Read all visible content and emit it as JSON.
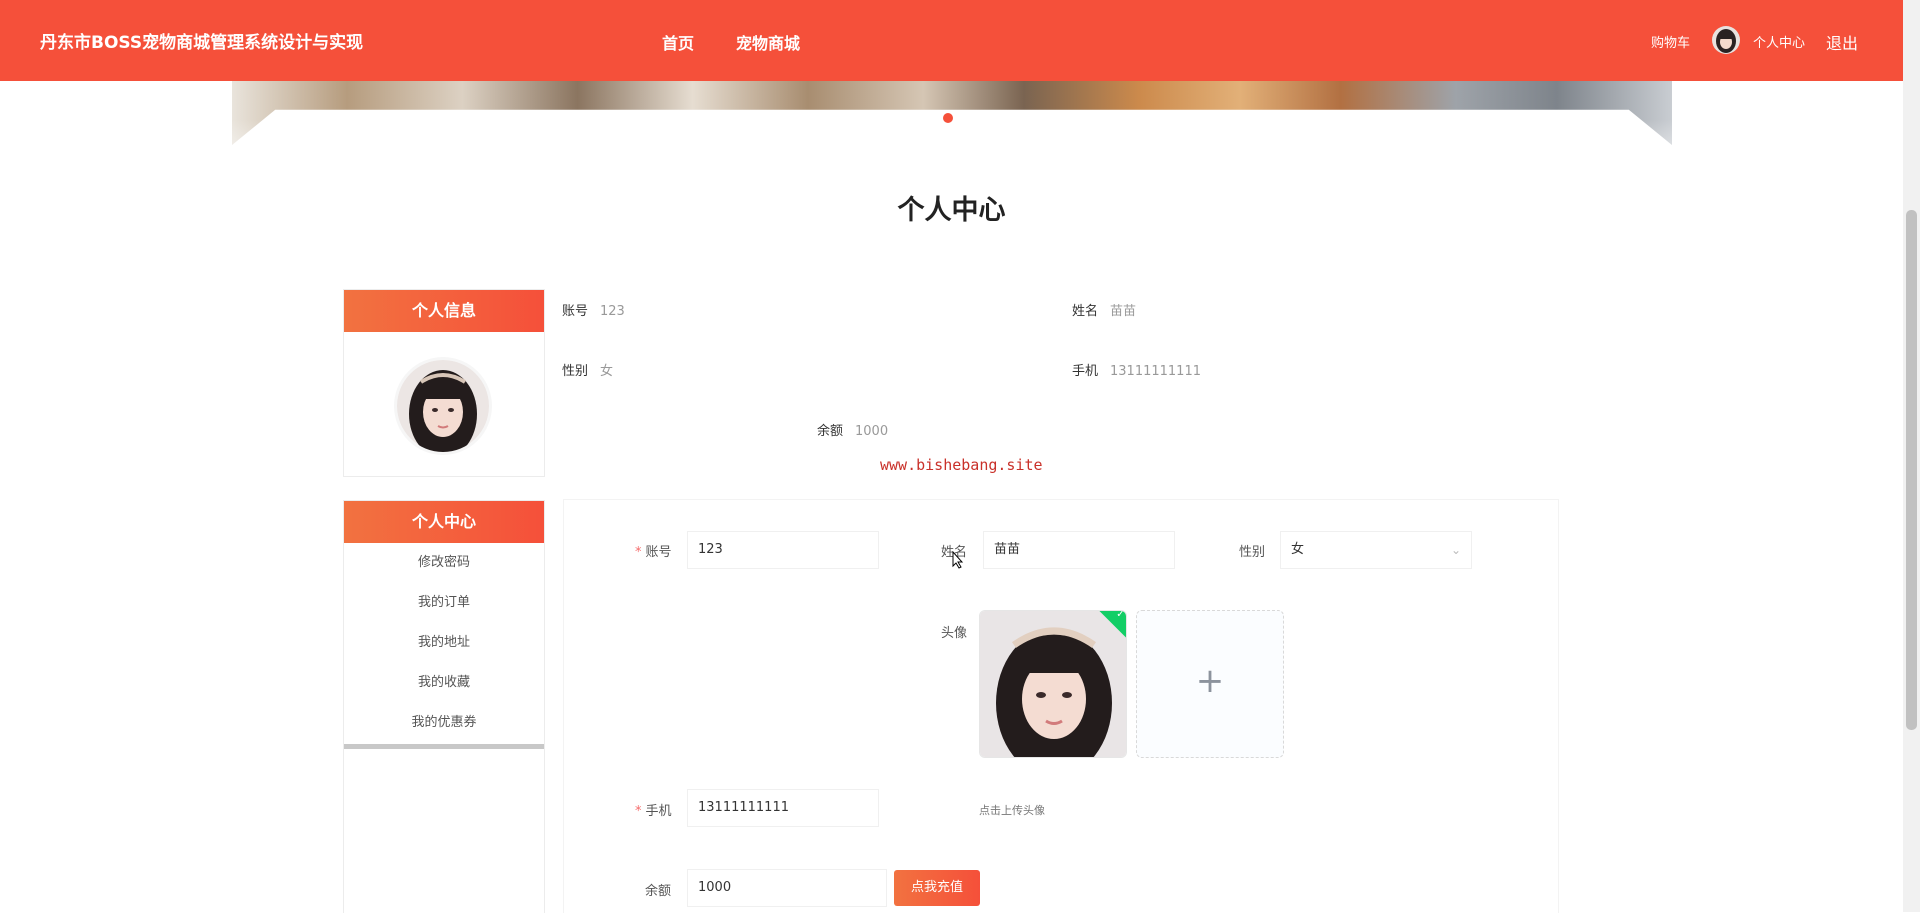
{
  "header": {
    "site_title": "丹东市BOSS宠物商城管理系统设计与实现",
    "nav": {
      "home": "首页",
      "mall": "宠物商城"
    },
    "cart": "购物车",
    "personal_center": "个人中心",
    "logout": "退出"
  },
  "banner": {
    "slides": 3,
    "active_slide": 2
  },
  "page_title": "个人中心",
  "side": {
    "info_title": "个人信息",
    "menu_title": "个人中心",
    "menu_items": [
      "修改密码",
      "我的订单",
      "我的地址",
      "我的收藏",
      "我的优惠券"
    ]
  },
  "info": {
    "account_label": "账号",
    "account_value": "123",
    "name_label": "姓名",
    "name_value": "苗苗",
    "gender_label": "性别",
    "gender_value": "女",
    "phone_label": "手机",
    "phone_value": "13111111111",
    "balance_label": "余额",
    "balance_value": "1000"
  },
  "watermark": "www.bishebang.site",
  "form": {
    "account_label": "账号",
    "account_value": "123",
    "name_label": "姓名",
    "name_value": "苗苗",
    "gender_label": "性别",
    "gender_value": "女",
    "avatar_label": "头像",
    "upload_tip": "点击上传头像",
    "phone_label": "手机",
    "phone_value": "13111111111",
    "balance_label": "余额",
    "balance_value": "1000",
    "recharge_button": "点我充值",
    "required_mark": "*",
    "upload_plus": "+",
    "uploaded_check": "✓"
  },
  "colors": {
    "primary": "#f5503a",
    "gradient_start": "#f27240",
    "success": "#13ce66",
    "watermark": "#c9312a"
  }
}
